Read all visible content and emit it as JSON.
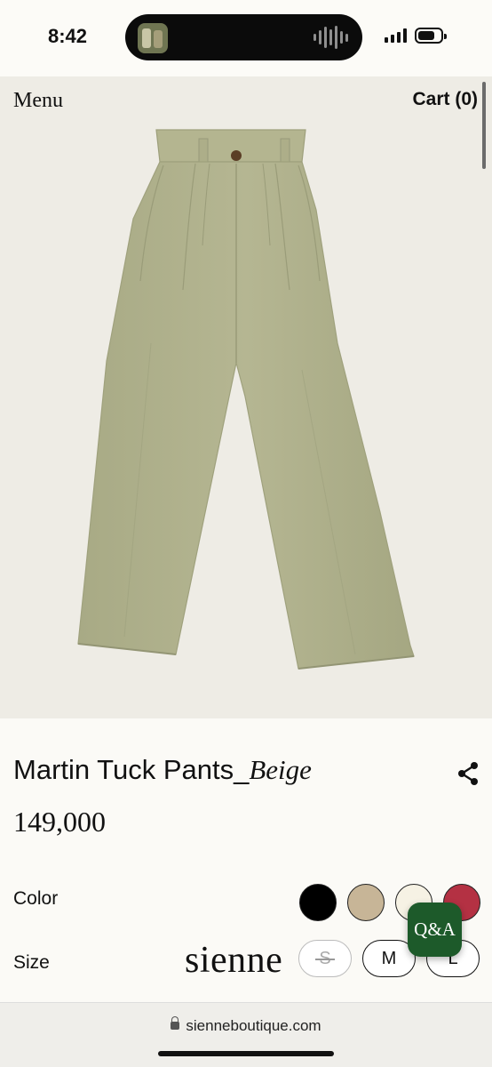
{
  "status_bar": {
    "time": "8:42"
  },
  "header": {
    "menu_label": "Menu",
    "cart_label": "Cart (0)"
  },
  "product": {
    "name": "Martin Tuck Pants_",
    "variant": "Beige",
    "price": "149,000",
    "image_icon": "pants-photo"
  },
  "options": {
    "color_label": "Color",
    "colors": [
      "#000000",
      "#c7b597",
      "#f6f2e4",
      "#b43143"
    ],
    "size_label": "Size",
    "sizes": [
      {
        "label": "S",
        "available": false
      },
      {
        "label": "M",
        "available": true
      },
      {
        "label": "L",
        "available": true
      }
    ]
  },
  "brand": {
    "logo_text": "sienne"
  },
  "qa_button": {
    "label": "Q&A",
    "color": "#1d5a2a"
  },
  "browser": {
    "url": "sienneboutique.com"
  },
  "icons": {
    "share": "share-icon",
    "lock": "lock-icon"
  }
}
